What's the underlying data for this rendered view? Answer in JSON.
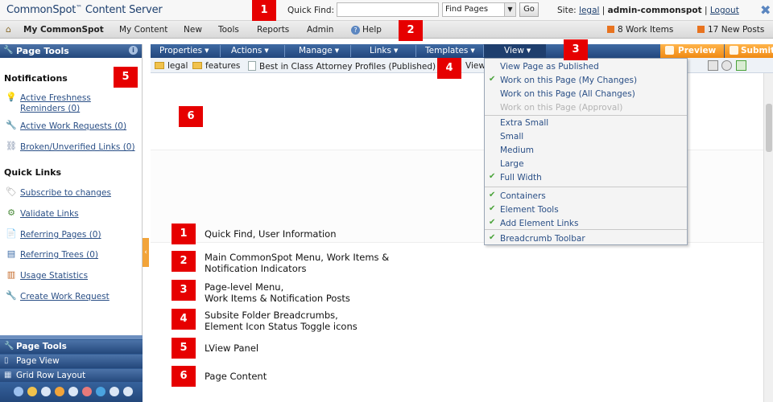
{
  "topbar": {
    "brand": "CommonSpot",
    "brand_tm": "™",
    "brand_suffix": " Content Server",
    "quick_find_label": "Quick Find:",
    "quick_find_value": "",
    "find_select": "Find Pages",
    "go_label": "Go",
    "site_label": "Site:",
    "site_name": "legal",
    "user_name": "admin-commonspot",
    "logout_label": "Logout",
    "close_glyph": "✖"
  },
  "main_menu": {
    "home": "My CommonSpot",
    "items": [
      "My Content",
      "New",
      "Tools",
      "Reports",
      "Admin"
    ],
    "help": "Help",
    "work_items": "8 Work Items",
    "new_posts": "17 New Posts"
  },
  "lview": {
    "title": "Page Tools",
    "notifications_title": "Notifications",
    "notifications": [
      "Active Freshness",
      "Reminders (0)",
      "Active Work Requests (0)",
      "Broken/Unverified Links (0)"
    ],
    "quick_links_title": "Quick Links",
    "quick_links": [
      "Subscribe to changes",
      "Validate Links",
      "Referring Pages (0)",
      "Referring Trees (0)",
      "Usage Statistics",
      "Create Work Request"
    ],
    "bottom_tabs": [
      "Page Tools",
      "Page View",
      "Grid Row Layout"
    ]
  },
  "page_menu": {
    "items": [
      "Properties",
      "Actions",
      "Manage",
      "Links",
      "Templates",
      "View"
    ],
    "preview": "Preview",
    "submit": "Submit"
  },
  "breadcrumb": {
    "folders": [
      "legal",
      "features"
    ],
    "page": "Best in Class Attorney Profiles (Published)",
    "view_label": "View"
  },
  "view_menu": {
    "items": [
      {
        "label": "View Page as Published",
        "checked": false,
        "disabled": false
      },
      {
        "label": "Work on this Page (My Changes)",
        "checked": true,
        "disabled": false
      },
      {
        "label": "Work on this Page (All Changes)",
        "checked": false,
        "disabled": false
      },
      {
        "label": "Work on this Page (Approval)",
        "checked": false,
        "disabled": true
      },
      {
        "label": "Extra Small",
        "checked": false,
        "disabled": false
      },
      {
        "label": "Small",
        "checked": false,
        "disabled": false
      },
      {
        "label": "Medium",
        "checked": false,
        "disabled": false
      },
      {
        "label": "Large",
        "checked": false,
        "disabled": false
      },
      {
        "label": "Full Width",
        "checked": true,
        "disabled": false
      },
      {
        "label": "Containers",
        "checked": true,
        "disabled": false
      },
      {
        "label": "Element Tools",
        "checked": true,
        "disabled": false
      },
      {
        "label": "Add Element Links",
        "checked": true,
        "disabled": false
      },
      {
        "label": "Breadcrumb Toolbar",
        "checked": true,
        "disabled": false
      }
    ],
    "check_glyph": "✔"
  },
  "callouts": [
    "1",
    "2",
    "3",
    "4",
    "5",
    "6"
  ],
  "legend": [
    {
      "num": "1",
      "lines": [
        "Quick Find, User Information"
      ]
    },
    {
      "num": "2",
      "lines": [
        "Main CommonSpot Menu, Work Items &",
        "Notification Indicators"
      ]
    },
    {
      "num": "3",
      "lines": [
        "Page-level Menu,",
        "Work Items & Notification Posts"
      ]
    },
    {
      "num": "4",
      "lines": [
        "Subsite Folder Breadcrumbs,",
        "Element Icon Status Toggle icons"
      ]
    },
    {
      "num": "5",
      "lines": [
        "LView Panel"
      ]
    },
    {
      "num": "6",
      "lines": [
        "Page Content"
      ]
    }
  ],
  "colors": {
    "callout_red": "#e60000",
    "toolbar_blue": "#22477d",
    "accent_orange": "#f08a14",
    "check_green": "#4aa33a",
    "link_blue": "#2a4f86"
  }
}
